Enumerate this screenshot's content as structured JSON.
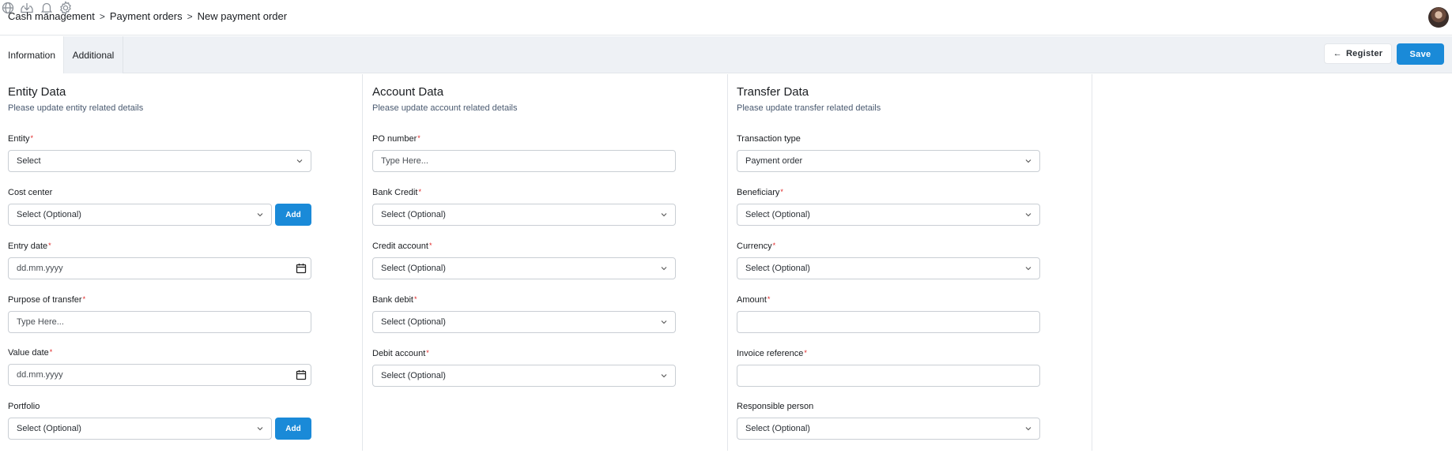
{
  "breadcrumb": [
    "Cash management",
    "Payment orders",
    "New payment order"
  ],
  "breadcrumb_sep": ">",
  "top_icons": [
    "globe-icon",
    "download-icon",
    "bell-icon",
    "gear-icon"
  ],
  "tabs": [
    {
      "label": "Information",
      "active": true
    },
    {
      "label": "Additional",
      "active": false
    }
  ],
  "actions": {
    "register_label": "Register",
    "save_label": "Save",
    "register_icon": "arrow-left-icon"
  },
  "colors": {
    "accent": "#1a8ad8",
    "required": "#e02424",
    "tabbar_bg": "#eef1f5"
  },
  "entity": {
    "title": "Entity Data",
    "subtitle": "Please update entity related details",
    "fields": {
      "entity": {
        "label": "Entity",
        "required": "*",
        "value": "Select"
      },
      "cost_center": {
        "label": "Cost center",
        "value": "Select (Optional)",
        "add_label": "Add"
      },
      "entry_date": {
        "label": "Entry date",
        "required": "*",
        "placeholder": "dd.mm.yyyy"
      },
      "purpose": {
        "label": "Purpose of transfer",
        "required": "*",
        "placeholder": "Type Here..."
      },
      "value_date": {
        "label": "Value date",
        "required": "*",
        "placeholder": "dd.mm.yyyy"
      },
      "portfolio": {
        "label": "Portfolio",
        "value": "Select (Optional)",
        "add_label": "Add"
      }
    }
  },
  "account": {
    "title": "Account Data",
    "subtitle": "Please update account related details",
    "fields": {
      "po_number": {
        "label": "PO number",
        "required": "*",
        "placeholder": "Type Here..."
      },
      "bank_credit": {
        "label": "Bank Credit",
        "required": "*",
        "value": "Select (Optional)"
      },
      "credit_account": {
        "label": "Credit account",
        "required": "*",
        "value": "Select (Optional)"
      },
      "bank_debit": {
        "label": "Bank debit",
        "required": "*",
        "value": "Select (Optional)"
      },
      "debit_account": {
        "label": "Debit account",
        "required": "*",
        "value": "Select (Optional)"
      }
    }
  },
  "transfer": {
    "title": "Transfer Data",
    "subtitle": "Please update transfer related details",
    "fields": {
      "transaction_type": {
        "label": "Transaction type",
        "value": "Payment order"
      },
      "beneficiary": {
        "label": "Beneficiary",
        "required": "*",
        "value": "Select (Optional)"
      },
      "currency": {
        "label": "Currency",
        "required": "*",
        "value": "Select (Optional)"
      },
      "amount": {
        "label": "Amount",
        "required": "*",
        "value": ""
      },
      "invoice_reference": {
        "label": "Invoice reference",
        "required": "*",
        "value": ""
      },
      "responsible_person": {
        "label": "Responsible person",
        "value": "Select (Optional)"
      }
    }
  }
}
